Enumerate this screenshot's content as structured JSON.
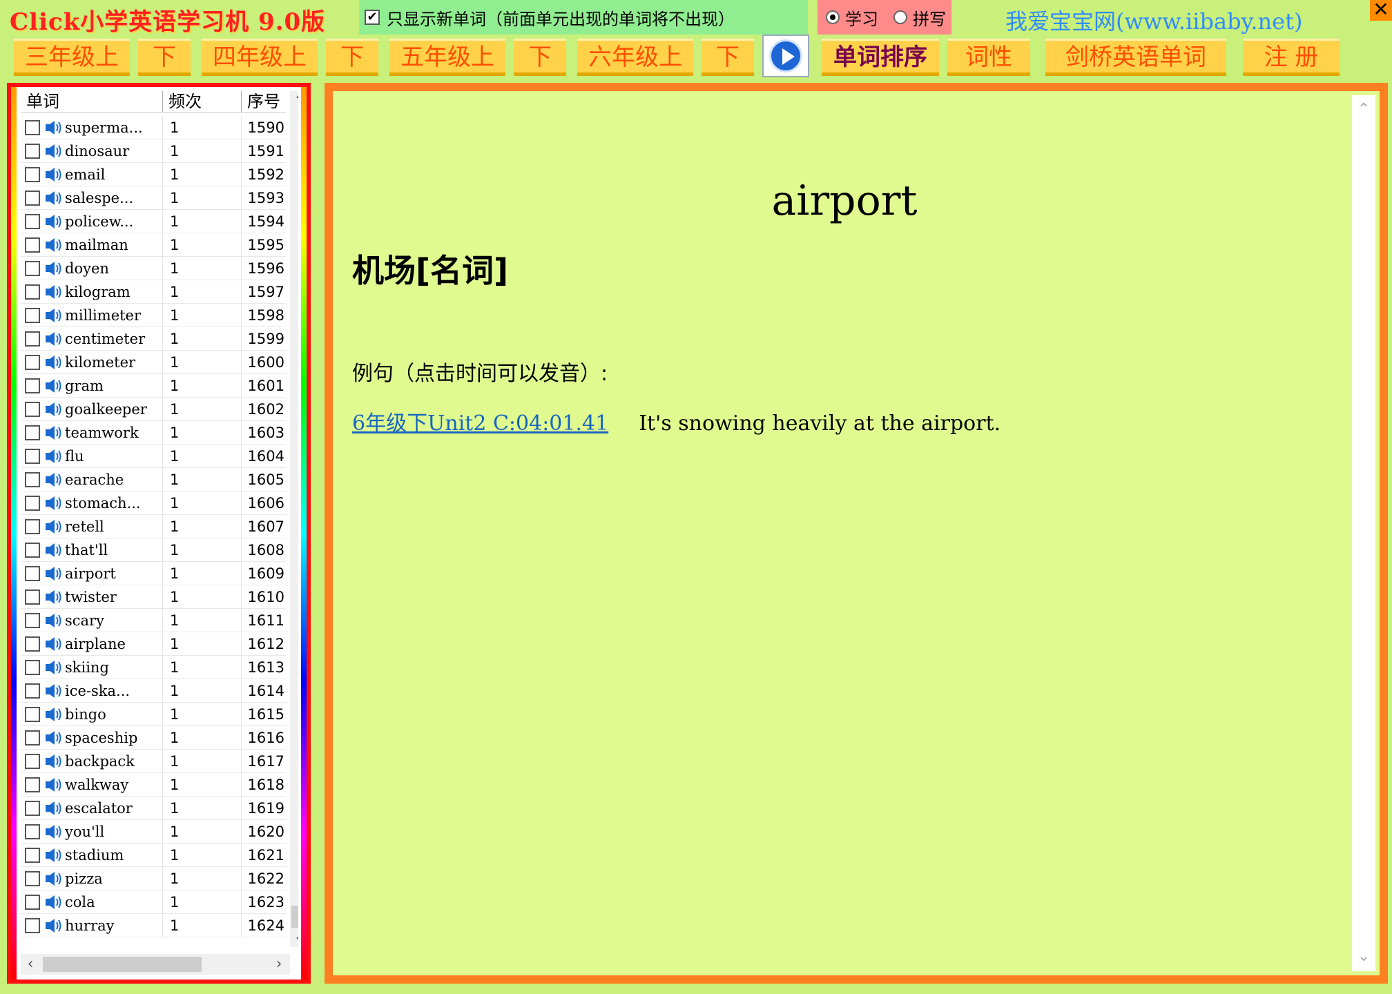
{
  "app": {
    "title": "Click小学英语学习机 9.0版",
    "new_words_only_label": "只显示新单词（前面单元出现的单词将不出现）",
    "new_words_only_checked": true,
    "mode_study": "学习",
    "mode_spell": "拼写",
    "selected_mode": "学习",
    "site": "我爱宝宝网(www.iibaby.net)",
    "close": "✕"
  },
  "nav": {
    "grade3_up": "三年级上",
    "grade3_down": "下",
    "grade4_up": "四年级上",
    "grade4_down": "下",
    "grade5_up": "五年级上",
    "grade5_down": "下",
    "grade6_up": "六年级上",
    "grade6_down": "下",
    "sort_words": "单词排序",
    "parts_of_speech": "词性",
    "cambridge": "剑桥英语单词",
    "register": "注 册"
  },
  "list": {
    "headers": {
      "word": "单词",
      "freq": "频次",
      "index": "序号"
    },
    "rows": [
      {
        "word": "superma...",
        "freq": "1",
        "index": "1590"
      },
      {
        "word": "dinosaur",
        "freq": "1",
        "index": "1591"
      },
      {
        "word": "email",
        "freq": "1",
        "index": "1592"
      },
      {
        "word": "salespe...",
        "freq": "1",
        "index": "1593"
      },
      {
        "word": "policew...",
        "freq": "1",
        "index": "1594"
      },
      {
        "word": "mailman",
        "freq": "1",
        "index": "1595"
      },
      {
        "word": "doyen",
        "freq": "1",
        "index": "1596"
      },
      {
        "word": "kilogram",
        "freq": "1",
        "index": "1597"
      },
      {
        "word": "millimeter",
        "freq": "1",
        "index": "1598"
      },
      {
        "word": "centimeter",
        "freq": "1",
        "index": "1599"
      },
      {
        "word": "kilometer",
        "freq": "1",
        "index": "1600"
      },
      {
        "word": "gram",
        "freq": "1",
        "index": "1601"
      },
      {
        "word": "goalkeeper",
        "freq": "1",
        "index": "1602"
      },
      {
        "word": "teamwork",
        "freq": "1",
        "index": "1603"
      },
      {
        "word": "flu",
        "freq": "1",
        "index": "1604"
      },
      {
        "word": "earache",
        "freq": "1",
        "index": "1605"
      },
      {
        "word": "stomach...",
        "freq": "1",
        "index": "1606"
      },
      {
        "word": "retell",
        "freq": "1",
        "index": "1607"
      },
      {
        "word": "that'll",
        "freq": "1",
        "index": "1608"
      },
      {
        "word": "airport",
        "freq": "1",
        "index": "1609"
      },
      {
        "word": "twister",
        "freq": "1",
        "index": "1610"
      },
      {
        "word": "scary",
        "freq": "1",
        "index": "1611"
      },
      {
        "word": "airplane",
        "freq": "1",
        "index": "1612"
      },
      {
        "word": "skiing",
        "freq": "1",
        "index": "1613"
      },
      {
        "word": "ice-ska...",
        "freq": "1",
        "index": "1614"
      },
      {
        "word": "bingo",
        "freq": "1",
        "index": "1615"
      },
      {
        "word": "spaceship",
        "freq": "1",
        "index": "1616"
      },
      {
        "word": "backpack",
        "freq": "1",
        "index": "1617"
      },
      {
        "word": "walkway",
        "freq": "1",
        "index": "1618"
      },
      {
        "word": "escalator",
        "freq": "1",
        "index": "1619"
      },
      {
        "word": "you'll",
        "freq": "1",
        "index": "1620"
      },
      {
        "word": "stadium",
        "freq": "1",
        "index": "1621"
      },
      {
        "word": "pizza",
        "freq": "1",
        "index": "1622"
      },
      {
        "word": "cola",
        "freq": "1",
        "index": "1623"
      },
      {
        "word": "hurray",
        "freq": "1",
        "index": "1624"
      }
    ]
  },
  "detail": {
    "headword": "airport",
    "meaning": "机场[名词]",
    "example_label": "例句（点击时间可以发音）:",
    "example_link": "6年级下Unit2 C:04:01.41",
    "example_text": "It's snowing heavily at the airport."
  },
  "colors": {
    "background": "#c8f07a",
    "panel_bg": "#e0fa90",
    "left_border": "#ff1010",
    "right_border": "#ff8020",
    "button_bg": "#ffd24a",
    "button_text": "#ff4e00"
  }
}
